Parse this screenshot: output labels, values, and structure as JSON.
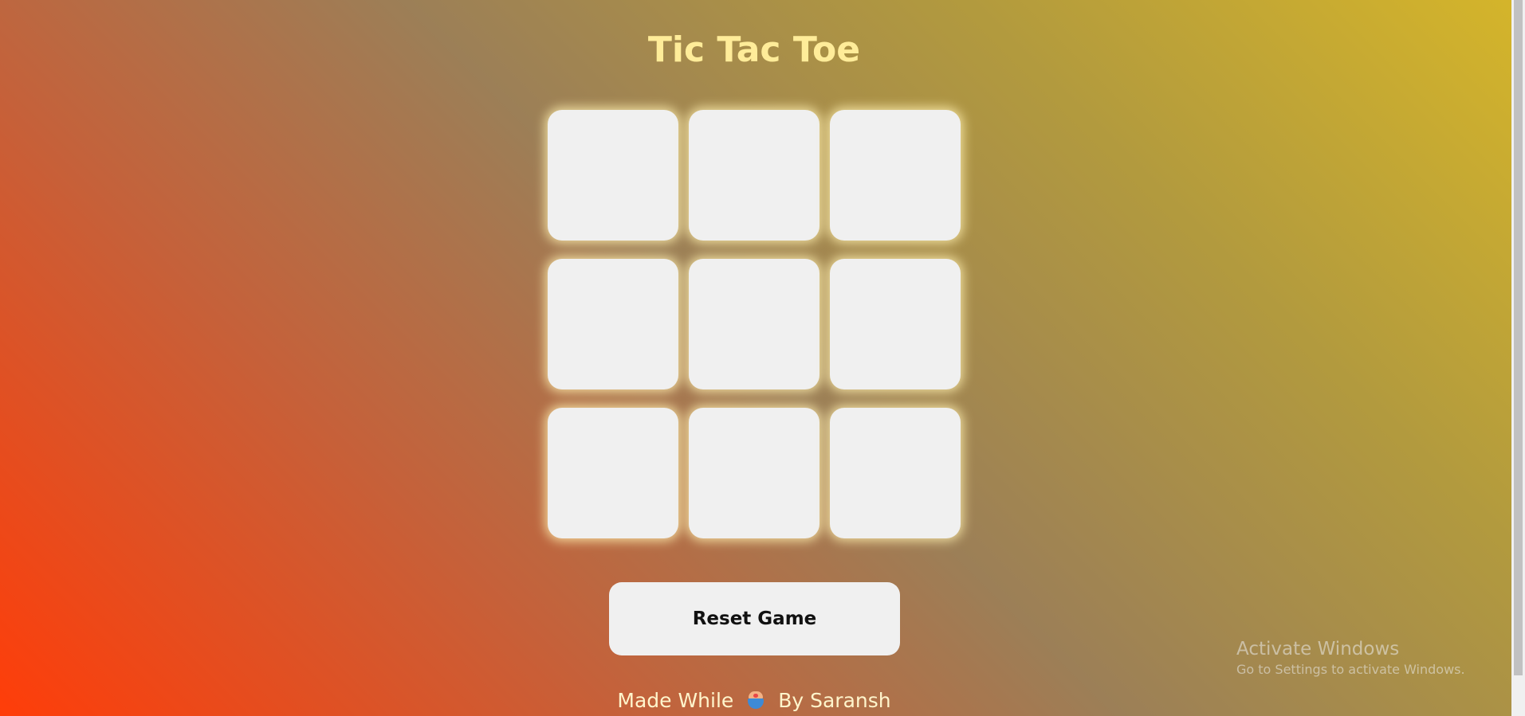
{
  "game": {
    "title": "Tic Tac Toe",
    "board": [
      "",
      "",
      "",
      "",
      "",
      "",
      "",
      "",
      ""
    ]
  },
  "controls": {
    "reset_label": "Reset Game"
  },
  "footer": {
    "prefix": "Made While",
    "icon": "coffee-cup-icon",
    "suffix": "By Saransh"
  },
  "watermark": {
    "title": "Activate Windows",
    "subtitle": "Go to Settings to activate Windows."
  },
  "colors": {
    "title": "#ffec99",
    "cell": "#f0f0f0",
    "gradient_start": "#ff3d09",
    "gradient_end": "#d5b52a"
  }
}
